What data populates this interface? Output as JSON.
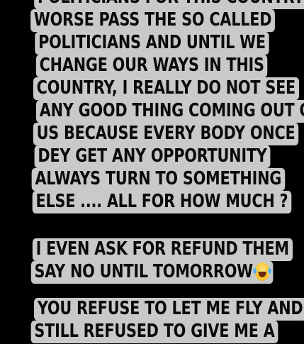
{
  "story": {
    "block1": [
      "POLITICIANS FOR THIS COUNTRY",
      "WORSE PASS THE SO CALLED",
      "POLITICIANS AND UNTIL WE",
      "CHANGE OUR WAYS IN THIS",
      "COUNTRY, I REALLY DO NOT SEE",
      "ANY GOOD THING COMING OUT OF",
      "US BECAUSE EVERY BODY ONCE",
      "DEY GET ANY OPPORTUNITY",
      "ALWAYS TURN TO SOMETHING",
      "ELSE .... ALL FOR HOW MUCH ?"
    ],
    "block2": [
      "I EVEN ASK FOR REFUND THEM",
      "SAY NO UNTIL TOMORROW"
    ],
    "block2_emoji": "face-with-tears-of-joy-icon",
    "block3": [
      "YOU REFUSE TO LET ME FLY  AND",
      "STILL  REFUSED TO GIVE ME A"
    ]
  }
}
